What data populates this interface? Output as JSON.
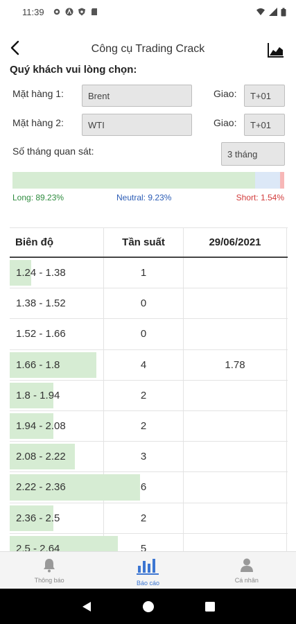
{
  "status_bar": {
    "time": "11:39"
  },
  "header": {
    "title": "Công cụ Trading Crack"
  },
  "form": {
    "prompt": "Quý khách vui lòng chọn:",
    "item1_label": "Mặt hàng 1:",
    "item1_value": "Brent",
    "item2_label": "Mặt hàng 2:",
    "item2_value": "WTI",
    "delivery_label": "Giao:",
    "delivery1_value": "T+01",
    "delivery2_value": "T+01",
    "months_label": "Số tháng quan sát:",
    "months_value": "3 tháng"
  },
  "sentiment": {
    "long_pct": 89.23,
    "neutral_pct": 9.23,
    "short_pct": 1.54,
    "long_label": "Long: 89.23%",
    "neutral_label": "Neutral: 9.23%",
    "short_label": "Short: 1.54%",
    "colors": {
      "long": "#d6ecd3",
      "neutral": "#dce8f7",
      "short": "#f7b7b7"
    }
  },
  "table": {
    "headers": [
      "Biên độ",
      "Tần suất",
      "29/06/2021"
    ],
    "max_freq": 8,
    "rows": [
      {
        "range": "1.24 - 1.38",
        "freq": "1",
        "date_value": ""
      },
      {
        "range": "1.38 - 1.52",
        "freq": "0",
        "date_value": ""
      },
      {
        "range": "1.52 - 1.66",
        "freq": "0",
        "date_value": ""
      },
      {
        "range": "1.66 - 1.8",
        "freq": "4",
        "date_value": "1.78"
      },
      {
        "range": "1.8 - 1.94",
        "freq": "2",
        "date_value": ""
      },
      {
        "range": "1.94 - 2.08",
        "freq": "2",
        "date_value": ""
      },
      {
        "range": "2.08 - 2.22",
        "freq": "3",
        "date_value": ""
      },
      {
        "range": "2.22 - 2.36",
        "freq": "6",
        "date_value": ""
      },
      {
        "range": "2.36 - 2.5",
        "freq": "2",
        "date_value": ""
      },
      {
        "range": "2.5 - 2.64",
        "freq": "5",
        "date_value": ""
      }
    ]
  },
  "bottom_nav": {
    "items": [
      {
        "label": "Thông báo",
        "icon": "bell-icon"
      },
      {
        "label": "Báo cáo",
        "icon": "bar-chart-icon"
      },
      {
        "label": "Cá nhân",
        "icon": "person-icon"
      }
    ],
    "active_index": 1,
    "active_color": "#3c76d2"
  }
}
